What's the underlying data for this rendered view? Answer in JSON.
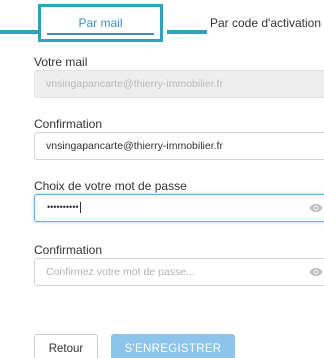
{
  "tabs": {
    "mail": "Par mail",
    "activation_code": "Par code d'activation"
  },
  "email": {
    "label": "Votre mail",
    "value": "vnsingapancarte@thierry-immobilier.fr"
  },
  "email_confirm": {
    "label": "Confirmation",
    "value": "vnsingapancarte@thierry-immobilier.fr"
  },
  "password": {
    "label": "Choix de votre mot de passe",
    "masked_value": "••••••••••"
  },
  "password_confirm": {
    "label": "Confirmation",
    "placeholder": "Confirmez votre mot de passe..."
  },
  "buttons": {
    "back": "Retour",
    "register": "S'ENREGISTRER"
  },
  "icons": {
    "password_toggle": "eye-icon",
    "password_confirm_toggle": "eye-icon"
  },
  "colors": {
    "highlight": "#2aa4b8",
    "tab_active_text": "#3d8fd0",
    "register_button": "#8cc4ec",
    "focus_border": "#66afe9"
  }
}
